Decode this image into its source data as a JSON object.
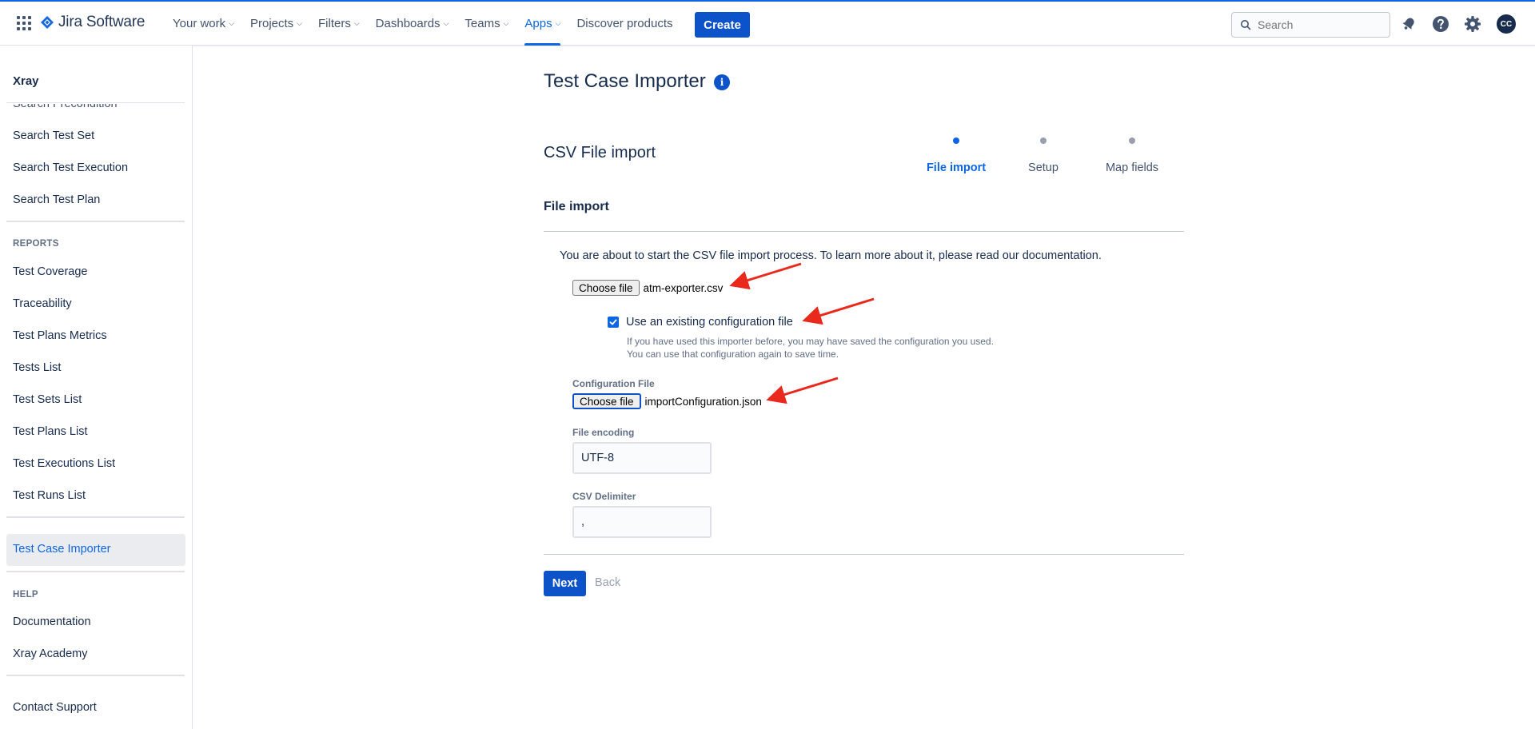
{
  "topnav": {
    "logo_text": "Jira Software",
    "items": [
      {
        "label": "Your work",
        "has_chevron": true
      },
      {
        "label": "Projects",
        "has_chevron": true
      },
      {
        "label": "Filters",
        "has_chevron": true
      },
      {
        "label": "Dashboards",
        "has_chevron": true
      },
      {
        "label": "Teams",
        "has_chevron": true
      },
      {
        "label": "Apps",
        "has_chevron": true,
        "active": true
      },
      {
        "label": "Discover products",
        "has_chevron": false
      }
    ],
    "create_label": "Create",
    "search_placeholder": "Search",
    "avatar_initials": "CC",
    "icons": [
      "apps-grid-icon",
      "jira-logo-icon",
      "search-icon",
      "notifications-icon",
      "help-icon",
      "settings-icon"
    ]
  },
  "sidebar": {
    "title": "Xray",
    "clipped_item": "Search Precondition",
    "search_items": [
      "Search Test Set",
      "Search Test Execution",
      "Search Test Plan"
    ],
    "reports_heading": "REPORTS",
    "reports_items": [
      "Test Coverage",
      "Traceability",
      "Test Plans Metrics",
      "Tests List",
      "Test Sets List",
      "Test Plans List",
      "Test Executions List",
      "Test Runs List"
    ],
    "selected_item": "Test Case Importer",
    "help_heading": "HELP",
    "help_items": [
      "Documentation",
      "Xray Academy"
    ],
    "contact_item": "Contact Support"
  },
  "main": {
    "page_title": "Test Case Importer",
    "section_title": "CSV File import",
    "steps": [
      {
        "label": "File import",
        "active": true
      },
      {
        "label": "Setup",
        "active": false
      },
      {
        "label": "Map fields",
        "active": false
      }
    ],
    "sub_title": "File import",
    "intro_text": "You are about to start the CSV file import process. To learn more about it, please read our documentation.",
    "csv_file": {
      "button_label": "Choose file",
      "file_name": "atm-exporter.csv"
    },
    "use_existing_config": {
      "checked": true,
      "label": "Use an existing configuration file",
      "helper": "If you have used this importer before, you may have saved the configuration you used. You can use that configuration again to save time."
    },
    "config_file": {
      "label": "Configuration File",
      "button_label": "Choose file",
      "file_name": "importConfiguration.json"
    },
    "file_encoding": {
      "label": "File encoding",
      "value": "UTF-8"
    },
    "csv_delimiter": {
      "label": "CSV Delimiter",
      "value": ","
    },
    "next_label": "Next",
    "back_label": "Back"
  },
  "colors": {
    "brand": "#0c66e4",
    "button": "#0c53c9",
    "annotation_arrow": "#e8291c",
    "selected_bg": "#ebecf0"
  }
}
